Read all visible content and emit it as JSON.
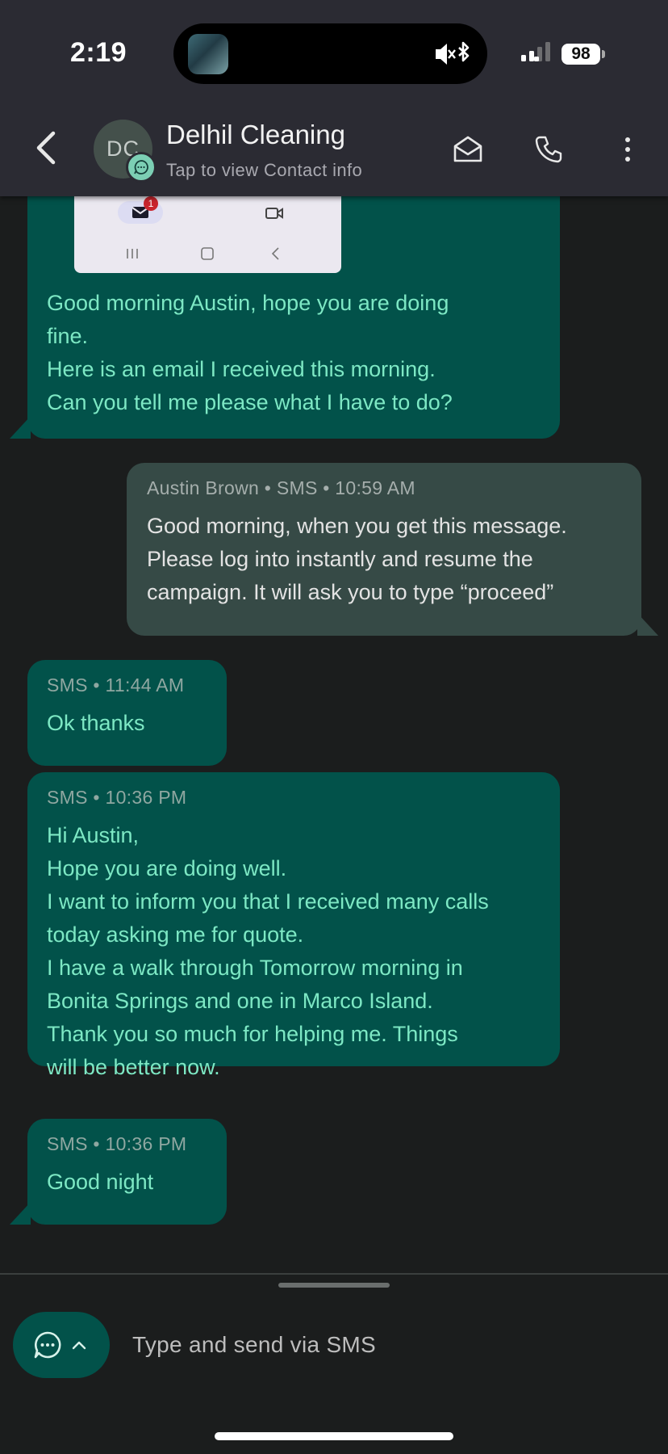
{
  "status_bar": {
    "time": "2:19",
    "battery": "98"
  },
  "header": {
    "avatar_initials": "DC",
    "contact_name": "Delhil Cleaning",
    "contact_subtitle": "Tap to view Contact info",
    "icons": [
      "back-arrow-icon",
      "envelope-icon",
      "phone-icon",
      "more-vertical-icon"
    ]
  },
  "attachment_preview": {
    "mail_badge": "1"
  },
  "messages": [
    {
      "direction": "incoming",
      "meta": "",
      "lines": [
        "Good morning Austin, hope you are doing",
        "fine.",
        "Here is an email I received this morning.",
        "Can you tell me please what I have to do?"
      ]
    },
    {
      "direction": "outgoing",
      "meta": "Austin Brown • SMS • 10:59 AM",
      "lines": [
        "Good morning, when you get this message.",
        "Please log into instantly and resume the",
        "campaign. It will ask you to type “proceed”"
      ]
    },
    {
      "direction": "incoming",
      "meta": "SMS • 11:44 AM",
      "lines": [
        "Ok thanks"
      ]
    },
    {
      "direction": "incoming",
      "meta": "SMS • 10:36 PM",
      "lines": [
        "Hi Austin,",
        "Hope you are doing well.",
        "I want to inform you that I received many calls",
        "today asking me for quote.",
        "I have a walk through Tomorrow morning in",
        "Bonita Springs and one in Marco Island.",
        "Thank you so much for helping me. Things",
        "will be better now."
      ]
    },
    {
      "direction": "incoming",
      "meta": "SMS • 10:36 PM",
      "lines": [
        "Good night"
      ]
    }
  ],
  "composer": {
    "placeholder": "Type and send via SMS"
  },
  "colors": {
    "incoming_bubble": "#02524a",
    "incoming_text": "#7de8c4",
    "outgoing_bubble": "#364a46",
    "header_bg": "#2b2b33",
    "background": "#1b1d1d"
  }
}
